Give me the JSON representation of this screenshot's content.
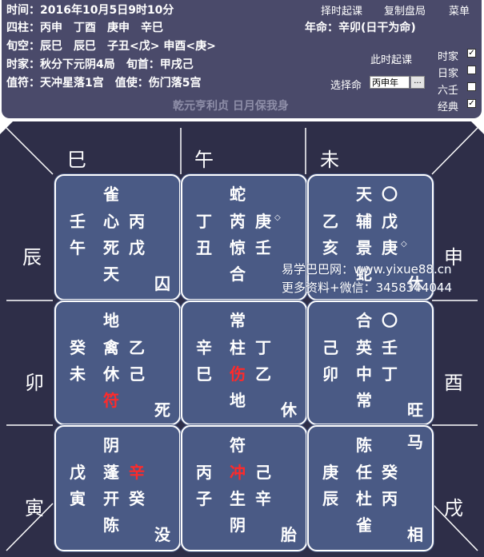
{
  "header": {
    "line1": "时间：2016年10月5日9时10分",
    "line2a": "四柱：丙申　丁酉　庚申　辛巳",
    "line2b": "年命：辛卯(日干为命)",
    "line3": "旬空：辰巳　辰巳　子丑<戊> 申酉<庚>",
    "line4": "时家：秋分下元阴4局　旬首：甲戌己",
    "line5": "值符：天冲星落1宫　值使：伤门落5宫",
    "motto": "乾元亨利贞 日月保我身"
  },
  "menu": {
    "m1": "择时起课",
    "m2": "复制盘局",
    "m3": "菜单"
  },
  "controls": {
    "now_label": "此时起课",
    "select_label": "选择命",
    "select_value": "丙申年",
    "select_btn": "...",
    "opt1": "时家",
    "opt2": "日家",
    "opt3": "六壬",
    "opt4": "经典",
    "checked": [
      "时家",
      "经典"
    ]
  },
  "branches": {
    "si": "巳",
    "wu": "午",
    "wei": "未",
    "chen": "辰",
    "shen": "申",
    "mao": "卯",
    "you": "酉",
    "yin": "寅",
    "xu": "戌"
  },
  "palaces": {
    "p4": {
      "top": "雀",
      "l1": "壬",
      "m1": "心",
      "r1": "丙",
      "l2": "午",
      "m2": "死",
      "r2": "戊",
      "m3": "天",
      "corner": "囚"
    },
    "p9": {
      "top": "蛇",
      "l1": "丁",
      "m1": "芮",
      "r1": "庚",
      "l2": "丑",
      "m2": "惊",
      "r2": "壬",
      "m3": "合"
    },
    "p2": {
      "top": "天",
      "topr": "〇",
      "l1": "乙",
      "m1": "辅",
      "r1": "戊",
      "l2": "亥",
      "m2": "景",
      "r2": "庚",
      "m3": "蛇",
      "corner": "休"
    },
    "p3": {
      "top": "地",
      "l1": "癸",
      "m1": "禽",
      "r1": "乙",
      "l2": "未",
      "m2": "休",
      "r2": "己",
      "m3": "符",
      "corner": "死"
    },
    "p5": {
      "top": "常",
      "l1": "辛",
      "m1": "柱",
      "r1": "丁",
      "l2": "巳",
      "m2": "伤",
      "r2": "乙",
      "m3": "地",
      "corner": "休"
    },
    "p7": {
      "top": "合",
      "topr": "〇",
      "l1": "己",
      "m1": "英",
      "r1": "壬",
      "l2": "卯",
      "m2": "中",
      "r2": "丁",
      "m3": "常",
      "corner": "旺"
    },
    "p8": {
      "top": "阴",
      "l1": "戊",
      "m1": "蓬",
      "r1": "辛",
      "l2": "寅",
      "m2": "开",
      "r2": "癸",
      "m3": "陈",
      "corner": "没"
    },
    "p1": {
      "top": "符",
      "l1": "丙",
      "m1": "冲",
      "r1": "己",
      "l2": "子",
      "m2": "生",
      "r2": "辛",
      "m3": "阴",
      "corner": "胎"
    },
    "p6": {
      "top": "陈",
      "topr": "马",
      "l1": "庚",
      "m1": "任",
      "r1": "癸",
      "l2": "辰",
      "m2": "杜",
      "r2": "丙",
      "m3": "雀",
      "corner": "相"
    }
  },
  "diamond": "◇",
  "watermark": {
    "line1": "易学巴巴网：www.yixue88.cn",
    "line2": "更多资料+微信：3458344044"
  },
  "colors": {
    "panel": "#4a4a6a",
    "palace": "#4a5a85",
    "outer": "#2e2e48",
    "highlight": "#ff2a2a"
  }
}
